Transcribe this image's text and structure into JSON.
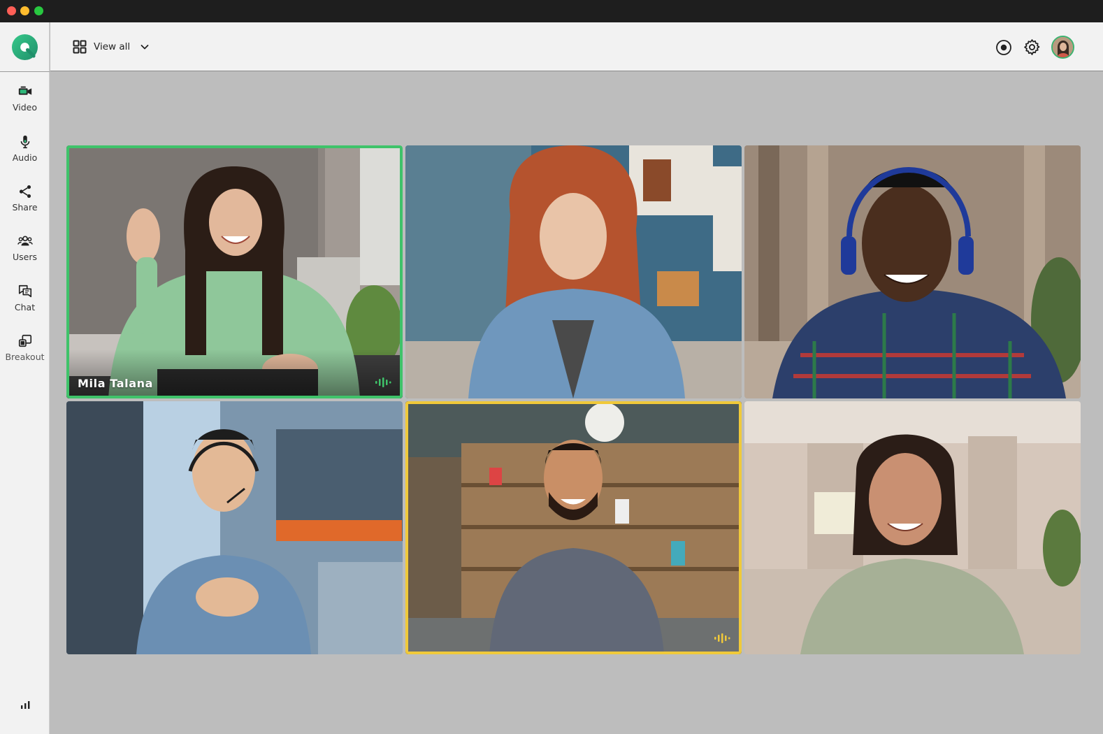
{
  "window": {
    "traffic_lights": [
      "#ff5f57",
      "#febc2e",
      "#28c840"
    ]
  },
  "sidebar": {
    "items": [
      {
        "label": "Video",
        "icon": "video-camera-icon"
      },
      {
        "label": "Audio",
        "icon": "microphone-icon"
      },
      {
        "label": "Share",
        "icon": "share-icon"
      },
      {
        "label": "Users",
        "icon": "users-icon"
      },
      {
        "label": "Chat",
        "icon": "chat-icon"
      },
      {
        "label": "Breakout",
        "icon": "breakout-icon"
      }
    ],
    "footer_icon": "signal-stats-icon"
  },
  "topbar": {
    "view_label": "View all",
    "view_icon": "grid-view-icon",
    "right_icons": [
      "record-icon",
      "gear-icon",
      "user-avatar"
    ]
  },
  "participants": [
    {
      "name": "Mila Talana",
      "state": "speaking",
      "ring_color": "#3fc36a"
    },
    {
      "name": "",
      "state": "idle"
    },
    {
      "name": "",
      "state": "idle"
    },
    {
      "name": "",
      "state": "idle"
    },
    {
      "name": "",
      "state": "active",
      "ring_color": "#f0c93a"
    },
    {
      "name": "",
      "state": "idle"
    }
  ],
  "colors": {
    "accent_green": "#3fc36a",
    "accent_yellow": "#f0c93a",
    "logo_green": "#2fb87a"
  }
}
